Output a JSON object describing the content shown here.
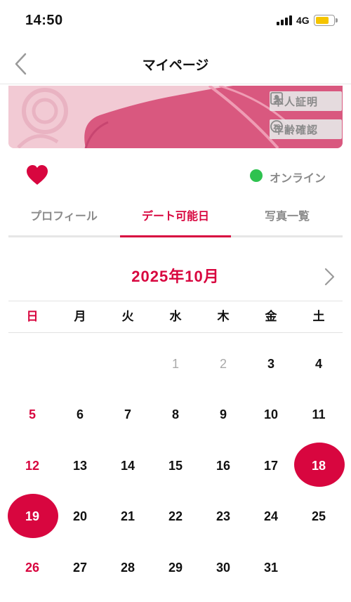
{
  "status_bar": {
    "time": "14:50",
    "network": "4G",
    "battery_level": 0.75
  },
  "header": {
    "title": "マイページ",
    "back_icon": "chevron-left-icon"
  },
  "profile": {
    "badges": [
      {
        "label": "本人証明",
        "icon": "id-card-icon"
      },
      {
        "label": "年齢確認",
        "icon": "age-18-icon"
      }
    ],
    "like_icon": "heart-icon",
    "online_status": "オンライン"
  },
  "tabs": [
    {
      "label": "プロフィール",
      "active": false
    },
    {
      "label": "デート可能日",
      "active": true
    },
    {
      "label": "写真一覧",
      "active": false
    }
  ],
  "calendar": {
    "month_title": "2025年10月",
    "next_icon": "chevron-right-icon",
    "weekdays": [
      "日",
      "月",
      "火",
      "水",
      "木",
      "金",
      "土"
    ],
    "weeks": [
      [
        null,
        null,
        null,
        "1",
        "2",
        "3",
        "4"
      ],
      [
        "5",
        "6",
        "7",
        "8",
        "9",
        "10",
        "11"
      ],
      [
        "12",
        "13",
        "14",
        "15",
        "16",
        "17",
        "18"
      ],
      [
        "19",
        "20",
        "21",
        "22",
        "23",
        "24",
        "25"
      ],
      [
        "26",
        "27",
        "28",
        "29",
        "30",
        "31",
        null
      ]
    ],
    "muted_days": [
      "1",
      "2"
    ],
    "selected_days": [
      "18",
      "19"
    ]
  },
  "colors": {
    "accent": "#d8063f",
    "online": "#2ec24f",
    "muted_text": "#8a8a8a",
    "battery": "#f5c400",
    "cover_pink": "#d9587f"
  }
}
